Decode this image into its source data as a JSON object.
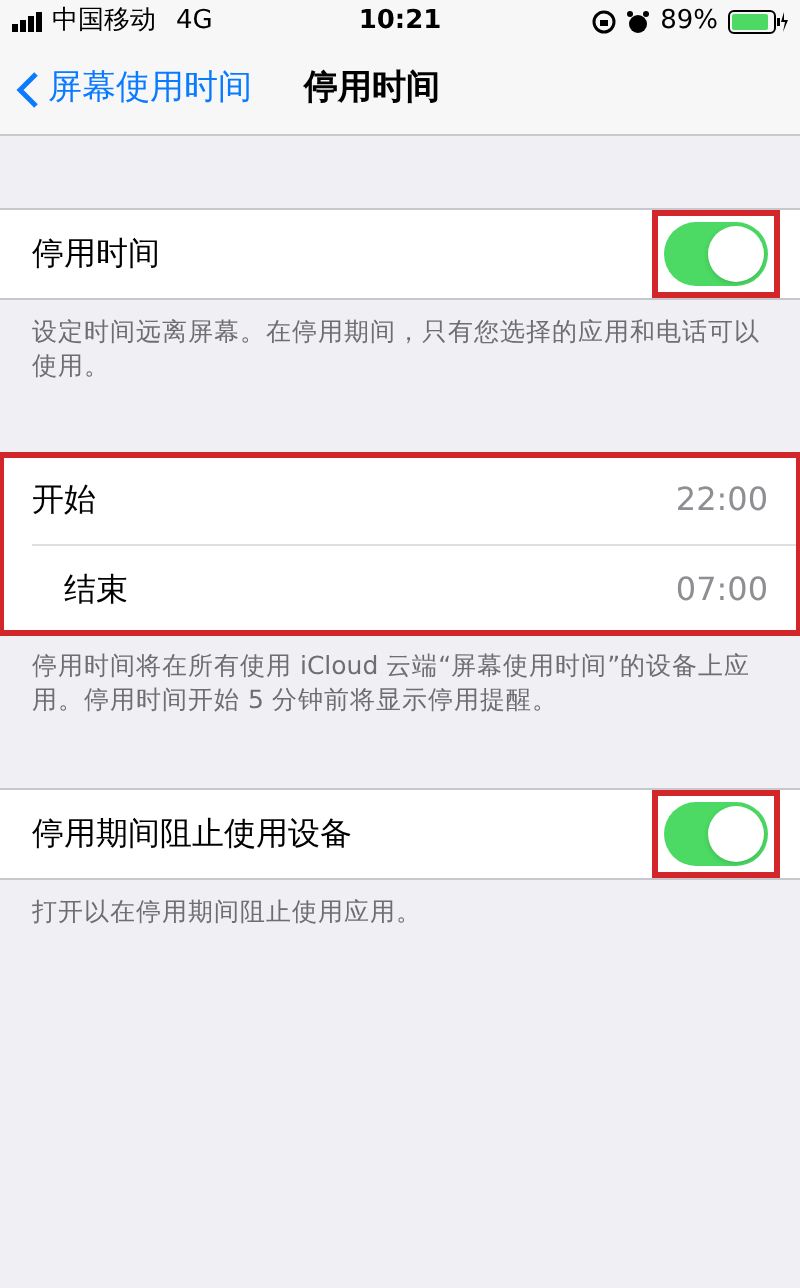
{
  "status_bar": {
    "carrier": "中国移动",
    "network": "4G",
    "time": "10:21",
    "battery": "89%"
  },
  "nav": {
    "back": "屏幕使用时间",
    "title": "停用时间"
  },
  "sections": [
    {
      "highlighted": false,
      "rows": [
        {
          "kind": "toggle",
          "label": "停用时间",
          "on": true,
          "highlighted": true
        }
      ],
      "footer": "设定时间远离屏幕。在停用期间，只有您选择的应用和电话可以使用。"
    },
    {
      "highlighted": true,
      "rows": [
        {
          "kind": "value",
          "label": "开始",
          "value": "22:00"
        },
        {
          "kind": "value",
          "label": "结束",
          "value": "07:00"
        }
      ],
      "footer": "停用时间将在所有使用 iCloud 云端“屏幕使用时间”的设备上应用。停用时间开始 5 分钟前将显示停用提醒。"
    },
    {
      "highlighted": false,
      "rows": [
        {
          "kind": "toggle",
          "label": "停用期间阻止使用设备",
          "on": true,
          "highlighted": true
        }
      ],
      "footer": "打开以在停用期间阻止使用应用。"
    }
  ]
}
